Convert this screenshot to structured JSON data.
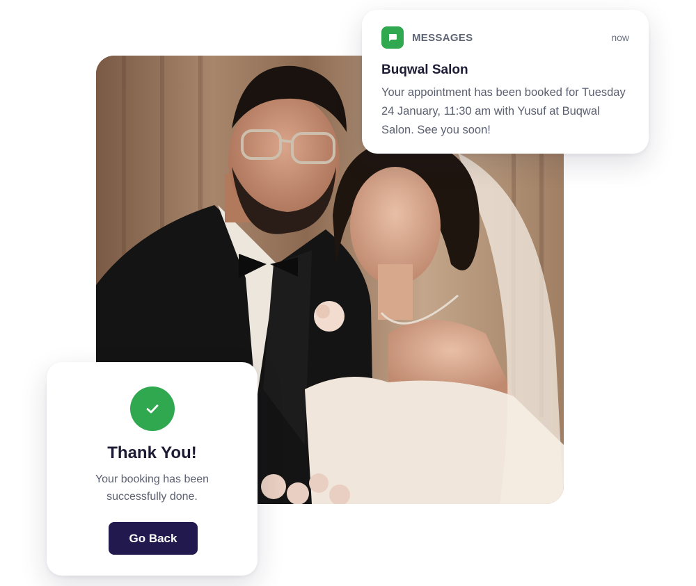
{
  "notification": {
    "app_name": "MESSAGES",
    "time": "now",
    "icon": "message-bubble-icon",
    "title": "Buqwal Salon",
    "body": "Your appointment has been booked for Tuesday 24 January, 11:30 am with Yusuf at Buqwal Salon. See you soon!"
  },
  "confirmation": {
    "icon": "check-icon",
    "title": "Thank You!",
    "message": "Your booking has been successfully done.",
    "button_label": "Go Back"
  },
  "colors": {
    "accent_green": "#2fa84f",
    "button_navy": "#221a4e",
    "heading": "#1c1b33",
    "body_text": "#5b6070"
  }
}
